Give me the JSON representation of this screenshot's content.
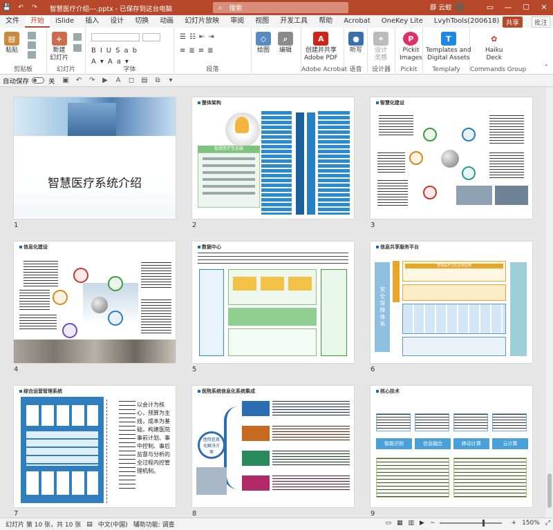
{
  "titlebar": {
    "doc_title": "智慧医疗介绍---.pptx - 已保存到这台电脑",
    "search_placeholder": "搜索",
    "user_name": "薛 云蛟",
    "ribbon_toggle_icon": "ribbon-display-icon",
    "minimize": "—",
    "maximize": "☐",
    "close": "✕"
  },
  "tabs": [
    "文件",
    "开始",
    "iSlide",
    "插入",
    "设计",
    "切换",
    "动画",
    "幻灯片放映",
    "审阅",
    "视图",
    "开发工具",
    "帮助",
    "Acrobat",
    "OneKey Lite",
    "LvyhTools(200618)"
  ],
  "active_tab": "开始",
  "share_label": "共享",
  "comment_label": "批注",
  "ribbon": {
    "groups": [
      {
        "label": "剪贴板",
        "buttons": [
          "粘贴"
        ]
      },
      {
        "label": "幻灯片",
        "buttons": [
          "新建\n幻灯片"
        ]
      },
      {
        "label": "字体",
        "buttons": []
      },
      {
        "label": "段落",
        "buttons": []
      },
      {
        "label": "",
        "buttons": [
          "绘图",
          "编辑"
        ]
      },
      {
        "label": "Adobe Acrobat",
        "buttons": [
          "创建并共享\nAdobe PDF"
        ]
      },
      {
        "label": "语音",
        "buttons": [
          "听写"
        ]
      },
      {
        "label": "设计器",
        "buttons": [
          "设计\n灵感"
        ]
      },
      {
        "label": "Pickit",
        "buttons": [
          "Pickit\nImages"
        ]
      },
      {
        "label": "Templafy",
        "buttons": [
          "Templates and\nDigital Assets"
        ]
      },
      {
        "label": "Commands Group",
        "buttons": [
          "Haiku\nDeck"
        ]
      }
    ]
  },
  "qat": {
    "autosave_label": "自动保存",
    "autosave_state": "关"
  },
  "slides": [
    {
      "number": "1",
      "title": "智慧医疗系统介绍"
    },
    {
      "number": "2",
      "title": "整体架构",
      "subtitle": "智慧医疗生态链"
    },
    {
      "number": "3",
      "title": "智慧化建设"
    },
    {
      "number": "4",
      "title": "信息化建设"
    },
    {
      "number": "5",
      "title": "数据中心"
    },
    {
      "number": "6",
      "title": "信息共享服务平台",
      "subtitle": "智慧医疗卫生业务应用",
      "sidebar": "安全保障体系"
    },
    {
      "number": "7",
      "title": "综合运营管理系统",
      "body": "以会计为核心，预算为主线，成本为基础，构建医院事前计划、事中控制、事后监督与分析的全过程内控管理机制。"
    },
    {
      "number": "8",
      "title": "医院系统信息化系统集成",
      "center": "医院信息化解决方案"
    },
    {
      "number": "9",
      "title": "核心技术",
      "items": [
        "智能识别",
        "信息融合",
        "移动计算",
        "云计算"
      ]
    }
  ],
  "statusbar": {
    "slide_info": "幻灯片 第 10 张，共 10 张",
    "language": "中文(中国)",
    "accessibility": "辅助功能: 调查",
    "zoom": "150%"
  }
}
